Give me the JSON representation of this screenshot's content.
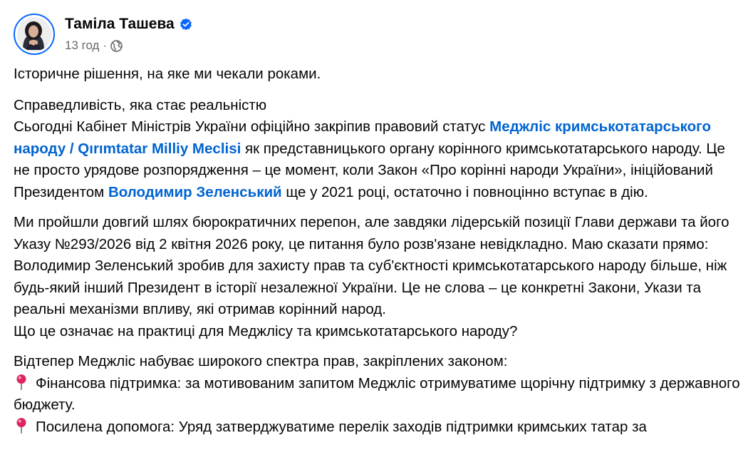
{
  "author": {
    "name": "Таміла Ташева",
    "time": "13 год",
    "separator": "·",
    "verified_icon": "verified-badge-icon",
    "audience_icon": "globe-icon"
  },
  "colors": {
    "link": "#0064d1",
    "verified": "#0866ff",
    "muted": "#65676b"
  },
  "post": {
    "p1": "Історичне рішення, на яке ми чекали роками.",
    "p2_line1": "Справедливість, яка стає реальністю",
    "p2_a": "Сьогодні Кабінет Міністрів України офіційно закріпив правовий статус ",
    "p2_link1": "Меджліс кримськотатарського народу / Qırımtatar Milliy Meclisi",
    "p2_b": " як представницького органу корінного кримськотатарського народу. Це не просто урядове розпорядження – це момент, коли Закон «Про корінні народи України», ініційований Президентом ",
    "p2_link2": "Володимир Зеленський",
    "p2_c": " ще у 2021 році, остаточно і повноцінно вступає в дію.",
    "p3": "Ми пройшли довгий шлях бюрократичних перепон, але завдяки лідерській позиції Глави держави та його Указу №293/2026 від 2 квітня 2026 року, це питання було розв'язане невідкладно. Маю сказати прямо: Володимир Зеленський зробив для захисту прав та суб'єктності кримськотатарського народу більше, ніж будь-який інший Президент в історії незалежної України. Це не слова – це конкретні Закони, Укази та реальні механізми впливу, які отримав корінний народ.",
    "p3_question": "Що це означає на практиці для Меджлісу та кримськотатарського народу?",
    "p4_intro": "Відтепер Меджліс набуває широкого спектра прав, закріплених законом:",
    "bullets": [
      {
        "icon": "round-pushpin-icon",
        "text": "Фінансова підтримка: за мотивованим запитом Меджліс отримуватиме щорічну підтримку з державного бюджету."
      },
      {
        "icon": "round-pushpin-icon",
        "text": "Посилена допомога: Уряд затверджуватиме перелік заходів підтримки кримських татар за"
      }
    ]
  }
}
